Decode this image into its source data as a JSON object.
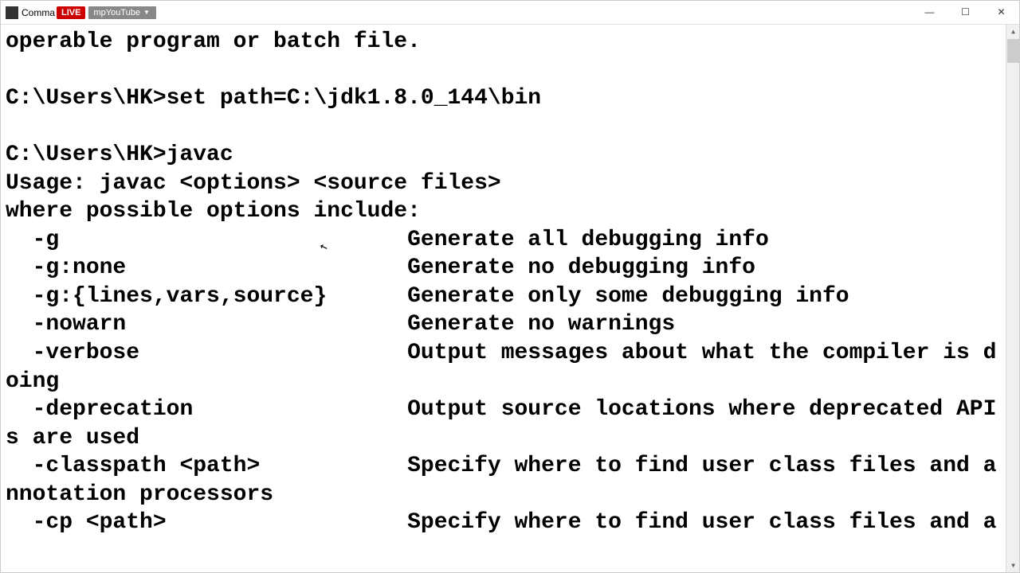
{
  "titlebar": {
    "app_title_left": "Comma",
    "live_badge": "LIVE",
    "youtube_label": "mpYouTube"
  },
  "window_controls": {
    "minimize": "—",
    "maximize": "☐",
    "close": "✕"
  },
  "terminal": {
    "line1": "operable program or batch file.",
    "blank1": "",
    "line2": "C:\\Users\\HK>set path=C:\\jdk1.8.0_144\\bin",
    "blank2": "",
    "line3": "C:\\Users\\HK>javac",
    "line4": "Usage: javac <options> <source files>",
    "line5": "where possible options include:",
    "opt1": "  -g                          Generate all debugging info",
    "opt2": "  -g:none                     Generate no debugging info",
    "opt3": "  -g:{lines,vars,source}      Generate only some debugging info",
    "opt4": "  -nowarn                     Generate no warnings",
    "opt5": "  -verbose                    Output messages about what the compiler is doing",
    "opt6": "  -deprecation                Output source locations where deprecated APIs are used",
    "opt7": "  -classpath <path>           Specify where to find user class files and annotation processors",
    "opt8": "  -cp <path>                  Specify where to find user class files and a"
  },
  "scrollbar": {
    "up": "▲",
    "down": "▼"
  }
}
